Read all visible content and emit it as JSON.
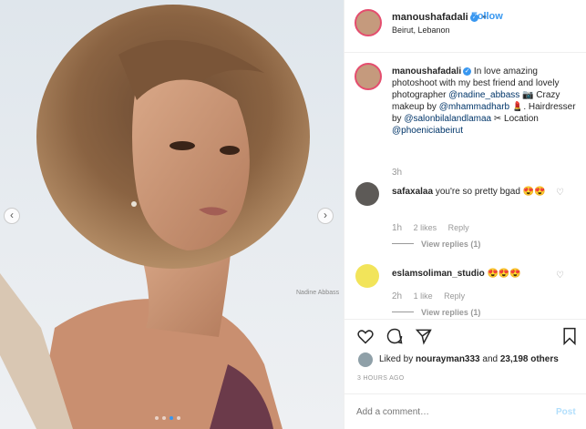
{
  "photo": {
    "watermark": "Nadine Abbass",
    "nav_prev": "‹",
    "nav_next": "›",
    "slide_count": 4,
    "active_slide": 3
  },
  "header": {
    "username": "manoushafadali",
    "verified": "✓",
    "separator": "•",
    "follow_label": "Follow",
    "location": "Beirut, Lebanon"
  },
  "caption": {
    "username": "manoushafadali",
    "text_1": " In love amazing photoshoot with my best friend and lovely photographer ",
    "mention_1": "@nadine_abbass",
    "text_2": " 📷 Crazy makeup by ",
    "mention_2": "@mhammadharb",
    "text_3": " 💄. Hairdresser by ",
    "mention_3": "@salonbilalandlamaa",
    "text_4": " ✂ Location ",
    "mention_4": "@phoeniciabeirut",
    "time": "3h"
  },
  "comments": [
    {
      "username": "safaxalaa",
      "text": " you're so pretty bgad 😍😍",
      "time": "1h",
      "likes": "2 likes",
      "reply": "Reply",
      "view_replies": "View replies (1)"
    },
    {
      "username": "eslamsoliman_studio",
      "text": " 😍😍😍",
      "time": "2h",
      "likes": "1 like",
      "reply": "Reply",
      "view_replies": "View replies (1)"
    }
  ],
  "likes": {
    "prefix": "Liked by ",
    "user": "nourayman333",
    "middle": " and ",
    "count": "23,198 others"
  },
  "posted_time": "3 HOURS AGO",
  "add_comment": {
    "placeholder": "Add a comment…",
    "post_label": "Post"
  },
  "colors": {
    "accent": "#3897f0",
    "story_ring": "#e44d6e"
  }
}
